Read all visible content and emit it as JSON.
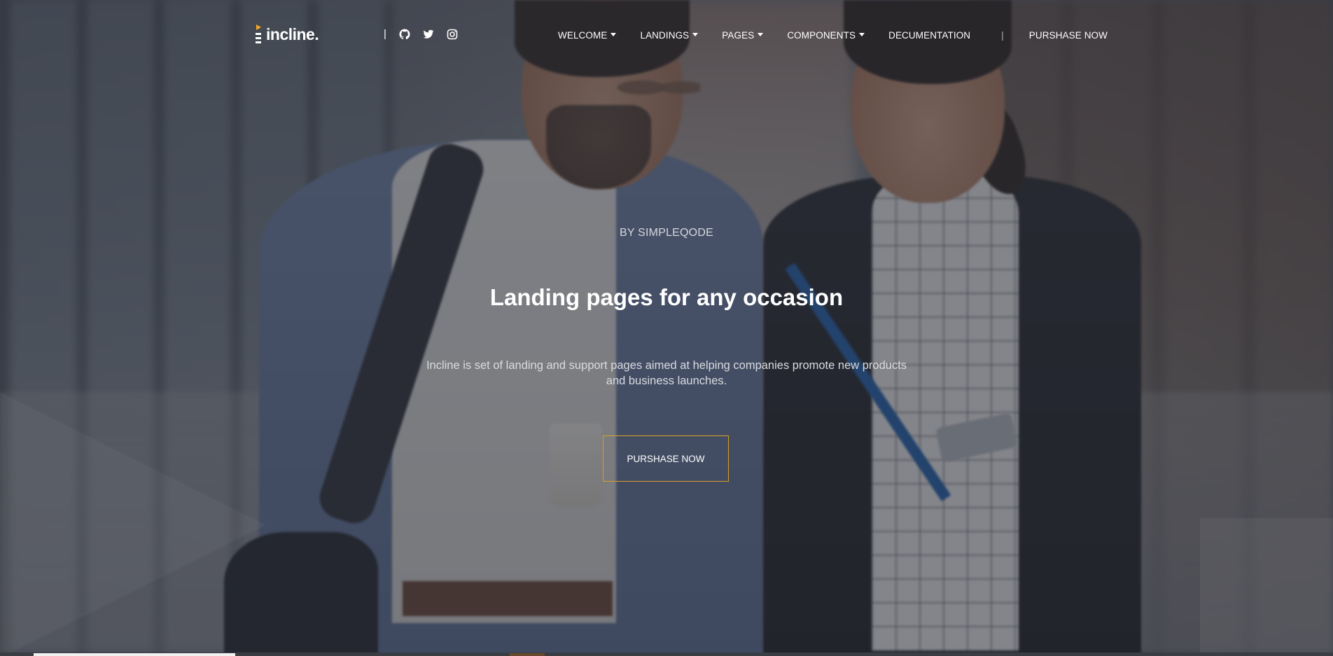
{
  "brand": {
    "name": "incline.",
    "mark_icon": "incline-logo-icon"
  },
  "social": {
    "separator": "|",
    "links": [
      {
        "name": "github-icon"
      },
      {
        "name": "twitter-icon"
      },
      {
        "name": "instagram-icon"
      }
    ]
  },
  "nav": {
    "items": [
      {
        "label": "WELCOME",
        "dropdown": true
      },
      {
        "label": "LANDINGS",
        "dropdown": true
      },
      {
        "label": "PAGES",
        "dropdown": true
      },
      {
        "label": "COMPONENTS",
        "dropdown": true
      },
      {
        "label": "DECUMENTATION",
        "dropdown": false
      }
    ],
    "separator": "|",
    "cta_label": "PURSHASE NOW"
  },
  "hero": {
    "kicker": "BY SIMPLEQODE",
    "title": "Landing pages for any occasion",
    "lead": "Incline is set of landing and support pages aimed at helping companies promote new products and business launches.",
    "cta_label": "PURSHASE NOW"
  },
  "colors": {
    "accent": "#d99e28",
    "logo_accent": "#f5a623",
    "overlay": "#282c36",
    "text": "#ffffff"
  }
}
